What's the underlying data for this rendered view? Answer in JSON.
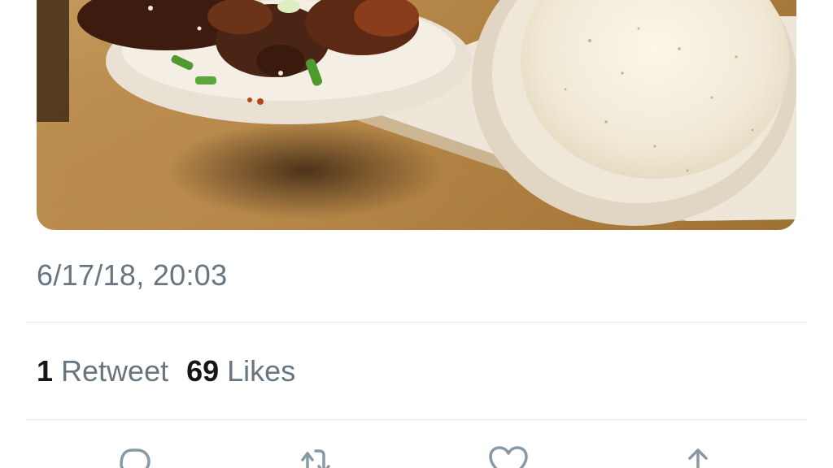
{
  "tweet": {
    "photo": {
      "alt_icon": "photo-icon"
    },
    "timestamp": "6/17/18, 20:03",
    "stats": {
      "retweets": {
        "count": "1",
        "label": "Retweet"
      },
      "likes": {
        "count": "69",
        "label": "Likes"
      }
    },
    "actions": [
      {
        "icon": "reply-icon"
      },
      {
        "icon": "retweet-icon"
      },
      {
        "icon": "like-icon"
      },
      {
        "icon": "share-icon"
      }
    ]
  },
  "colors": {
    "secondary_text": "#66757f",
    "primary_text": "#14171a",
    "icon": "#8899a6",
    "divider": "#e1e8ed"
  }
}
